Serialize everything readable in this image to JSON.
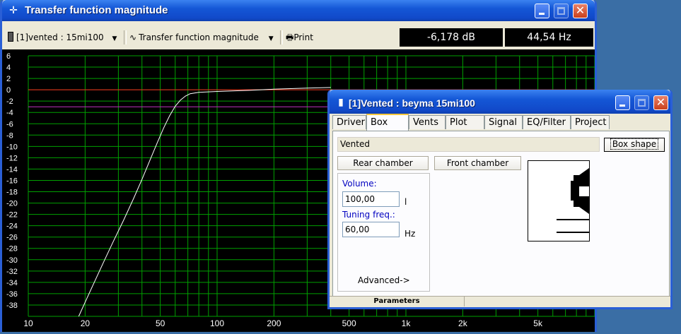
{
  "main_window": {
    "title": "Transfer function magnitude",
    "toolbar": {
      "driver_select": "[1]vented : 15mi100",
      "plot_select": "Transfer function magnitude",
      "print_label": "Print",
      "readout_db": "-6,178 dB",
      "readout_hz": "44,54 Hz"
    }
  },
  "chart_data": {
    "type": "line",
    "x_scale": "log",
    "xlim": [
      10,
      10000
    ],
    "ylim": [
      -40,
      6
    ],
    "grid": true,
    "x_tick_labels": [
      "10",
      "20",
      "50",
      "100",
      "200",
      "500",
      "1k",
      "2k",
      "5k"
    ],
    "x_tick_values": [
      10,
      20,
      50,
      100,
      200,
      500,
      1000,
      2000,
      5000
    ],
    "y_tick_values": [
      6,
      4,
      2,
      0,
      -2,
      -4,
      -6,
      -8,
      -10,
      -12,
      -14,
      -16,
      -18,
      -20,
      -22,
      -24,
      -26,
      -28,
      -30,
      -32,
      -34,
      -36,
      -38
    ],
    "reference_lines": [
      {
        "y": 0,
        "color": "#ff2020"
      },
      {
        "y": -3,
        "color": "#c030c0"
      }
    ],
    "series": [
      {
        "color": "#ffffff",
        "x": [
          18.5,
          20,
          22,
          25,
          28,
          32,
          36,
          40,
          44,
          48,
          52,
          56,
          60,
          64,
          68,
          72,
          80,
          100,
          150,
          200,
          300,
          400
        ],
        "y": [
          -40,
          -37.5,
          -34.5,
          -30.5,
          -27,
          -23,
          -19.3,
          -15.8,
          -12.5,
          -9.5,
          -6.8,
          -4.6,
          -2.9,
          -1.8,
          -1.1,
          -0.7,
          -0.45,
          -0.3,
          -0.1,
          0.1,
          0.3,
          0.4
        ]
      }
    ]
  },
  "dialog": {
    "title": "[1]Vented : beyma 15mi100",
    "tabs": [
      "Driver",
      "Box",
      "Vents",
      "Plot",
      "Signal",
      "EQ/Filter",
      "Project"
    ],
    "active_tab": "Box",
    "box_type": "Vented",
    "box_shape_button": "Box shape",
    "rear_chamber_button": "Rear chamber",
    "front_chamber_button": "Front chamber",
    "volume_label": "Volume:",
    "volume_value": "100,00",
    "volume_unit": "l",
    "tuning_label": "Tuning freq.:",
    "tuning_value": "60,00",
    "tuning_unit": "Hz",
    "advanced_label": "Advanced->",
    "status_label": "Parameters"
  }
}
